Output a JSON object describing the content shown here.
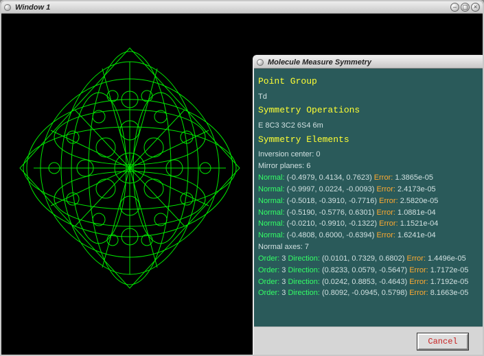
{
  "main": {
    "title": "Window 1"
  },
  "dialog": {
    "title": "Molecule Measure Symmetry",
    "headings": {
      "pointgroup": "Point Group",
      "symops": "Symmetry Operations",
      "symelem": "Symmetry Elements"
    },
    "pointgroup_value": "Td",
    "symops_value": "E 8C3 3C2 6S4 6m",
    "inversion_label": "Inversion center:",
    "inversion_value": "0",
    "mirror_label": "Mirror planes:",
    "mirror_count": "6",
    "mirror_planes": [
      {
        "n": "(-0.4979, 0.4134, 0.7623)",
        "e": "1.3865e-05"
      },
      {
        "n": "(-0.9997, 0.0224, -0.0093)",
        "e": "2.4173e-05"
      },
      {
        "n": "(-0.5018, -0.3910, -0.7716)",
        "e": "2.5820e-05"
      },
      {
        "n": "(-0.5190, -0.5776, 0.6301)",
        "e": "1.0881e-04"
      },
      {
        "n": "(-0.0210, -0.9910, -0.1322)",
        "e": "1.1521e-04"
      },
      {
        "n": "(-0.4808, 0.6000, -0.6394)",
        "e": "1.6241e-04"
      }
    ],
    "normal_key": "Normal:",
    "error_key": "Error:",
    "order_key": "Order:",
    "direction_key": "Direction:",
    "axes_label": "Normal axes:",
    "axes_count": "7",
    "normal_axes": [
      {
        "o": "3",
        "d": "(0.0101, 0.7329, 0.6802)",
        "e": "1.4496e-05"
      },
      {
        "o": "3",
        "d": "(0.8233, 0.0579, -0.5647)",
        "e": "1.7172e-05"
      },
      {
        "o": "3",
        "d": "(0.0242, 0.8853, -0.4643)",
        "e": "1.7192e-05"
      },
      {
        "o": "3",
        "d": "(0.8092, -0.0945, 0.5798)",
        "e": "8.1663e-05"
      }
    ],
    "cancel_label": "Cancel"
  }
}
